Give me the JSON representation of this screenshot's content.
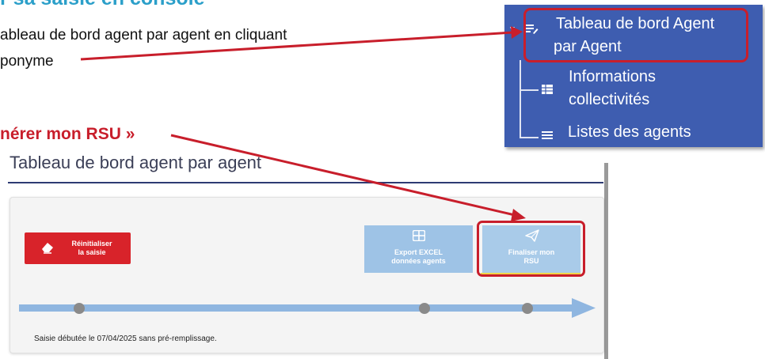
{
  "doc": {
    "heading": "r sa saisie en console",
    "instruction_line1": "ableau de bord agent par agent en cliquant",
    "instruction_line2": "ponyme",
    "generate_callout": "nérer mon RSU »"
  },
  "menu": {
    "item1_line1": "Tableau de bord Agent",
    "item1_line2": "par Agent",
    "item2_line1": "Informations",
    "item2_line2": "collectivités",
    "item3": "Listes des agents",
    "item1_icon": "list-edit-icon",
    "item2_icon": "table-icon",
    "item3_icon": "list-icon"
  },
  "panel": {
    "title": "Tableau de bord agent par agent",
    "reset_line1": "Réinitialiser",
    "reset_line2": "la saisie",
    "excel_line1": "Export EXCEL",
    "excel_line2": "données agents",
    "final_line1": "Finaliser mon",
    "final_line2": "RSU",
    "status_text": "Saisie débutée le 07/04/2025 sans pré-remplissage.",
    "reset_icon": "eraser-icon",
    "excel_icon": "grid-icon",
    "final_icon": "paper-plane-icon"
  },
  "colors": {
    "highlight": "#c81e2b",
    "menu_bg": "#3e5db0",
    "heading": "#2b9fc9",
    "reset_button": "#d8232a",
    "action_button": "#9ec3e6",
    "timeline": "#8fb6e0"
  }
}
